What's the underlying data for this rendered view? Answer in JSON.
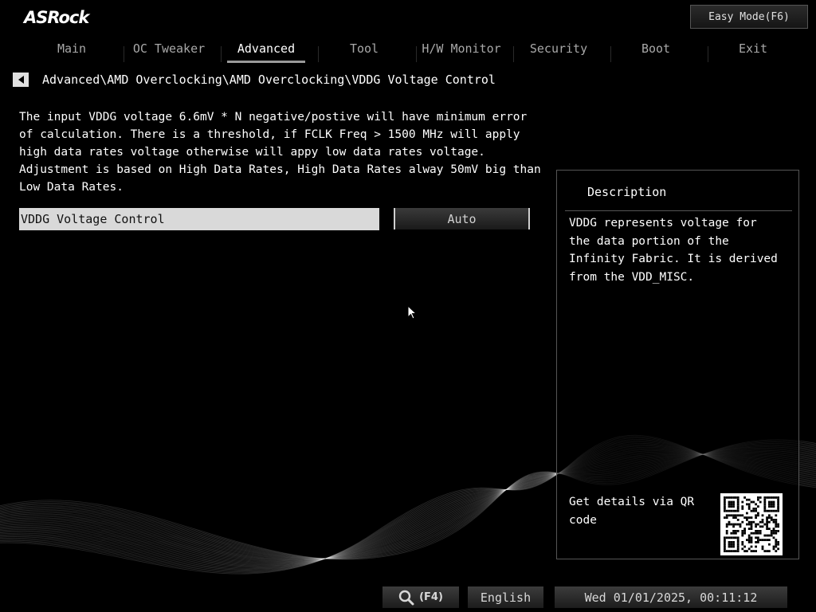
{
  "header": {
    "logo": "ASRock",
    "easy_mode_label": "Easy Mode(F6)"
  },
  "nav": {
    "tabs": [
      {
        "label": "Main",
        "active": false
      },
      {
        "label": "OC Tweaker",
        "active": false
      },
      {
        "label": "Advanced",
        "active": true
      },
      {
        "label": "Tool",
        "active": false
      },
      {
        "label": "H/W Monitor",
        "active": false
      },
      {
        "label": "Security",
        "active": false
      },
      {
        "label": "Boot",
        "active": false
      },
      {
        "label": "Exit",
        "active": false
      }
    ]
  },
  "breadcrumb": "Advanced\\AMD Overclocking\\AMD Overclocking\\VDDG Voltage Control",
  "help_text": "The input VDDG voltage 6.6mV * N negative/postive will have minimum error of calculation. There is a threshold, if FCLK Freq > 1500 MHz will apply high data rates voltage otherwise will appy low data rates voltage. Adjustment is based on High Data Rates, High Data Rates alway 50mV big than Low Data Rates.",
  "setting": {
    "label": "VDDG Voltage Control",
    "value": "Auto"
  },
  "description": {
    "title": "Description",
    "body": "VDDG represents voltage for the data portion of the Infinity Fabric. It is derived from the VDD_MISC.",
    "qr_caption": "Get details via QR code"
  },
  "footer": {
    "search_label": "(F4)",
    "language": "English",
    "datetime": "Wed 01/01/2025, 00:11:12"
  },
  "colors": {
    "background": "#000000",
    "text": "#ffffff",
    "label_bg": "#d9d9d9"
  },
  "icons": {
    "back": "back-arrow-icon",
    "search": "search-icon",
    "qr": "qr-code-icon"
  }
}
